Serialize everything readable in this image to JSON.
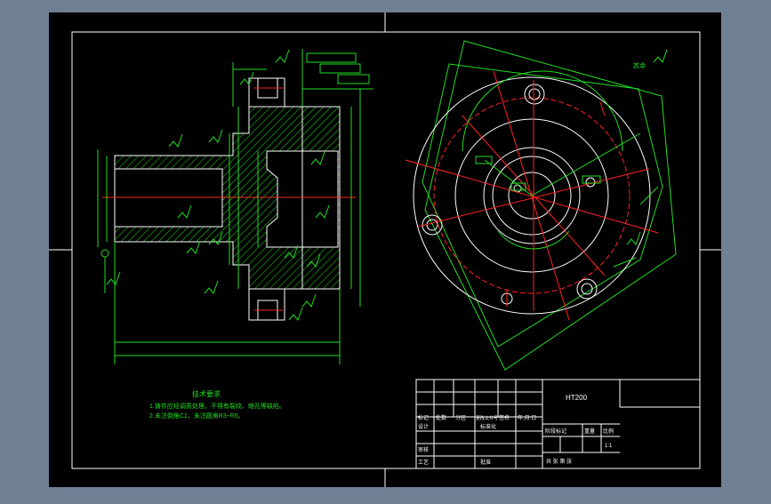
{
  "drawing": {
    "material": "HT200",
    "scale": "1:1",
    "other_roughness_label": "其余"
  },
  "technical_requirements": {
    "title": "技术要求",
    "items": [
      "1.铸件应经调质处理，不得有裂纹、缩孔等缺陷。",
      "2.未注倒角C1，未注圆角R3~R5。"
    ]
  },
  "title_block": {
    "header_cells": [
      "标记",
      "处数",
      "分区",
      "更改文件号",
      "签名",
      "年.月.日"
    ],
    "left_labels": [
      "设计",
      "标准化",
      "审核",
      "工艺",
      "批准"
    ],
    "right_labels": [
      "阶段标记",
      "重量",
      "比例"
    ],
    "bottom_right": "共  张  第  张"
  },
  "colors": {
    "background": "#6f7f94",
    "sheet": "#000000",
    "outline": "#ffffff",
    "dimension": "#22dd22",
    "centerline": "#ff2222",
    "hatch": "#22dd22"
  }
}
